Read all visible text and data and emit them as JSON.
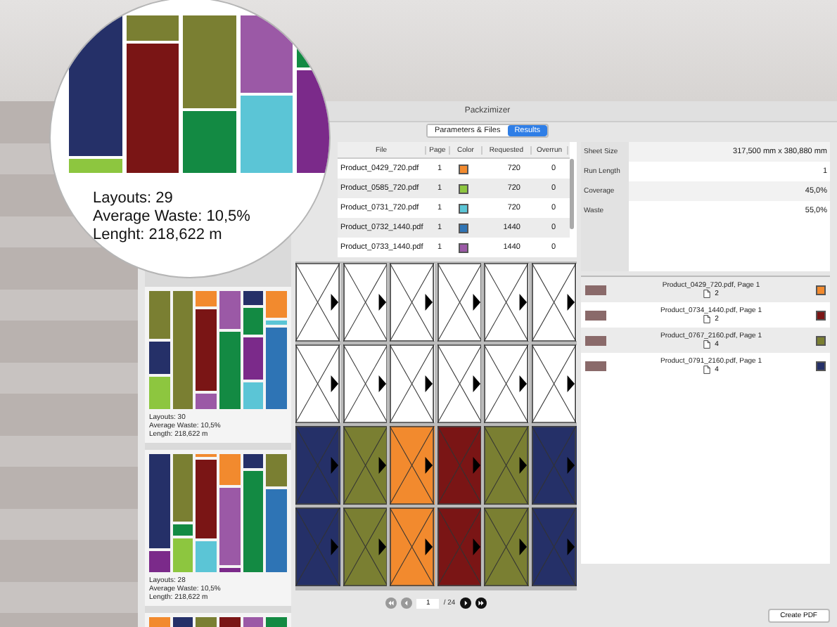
{
  "window": {
    "title": "Packzimizer"
  },
  "tabs": [
    {
      "label": "Parameters & Files",
      "selected": false
    },
    {
      "label": "Results",
      "selected": true
    }
  ],
  "magnifier": {
    "lines": [
      "Layouts: 29",
      "Average Waste: 10,5%",
      "Lenght: 218,622 m"
    ]
  },
  "layouts": [
    {
      "lines": [
        "Layouts: 30",
        "Average Waste: 10,5%",
        "Length: 218,622 m"
      ]
    },
    {
      "lines": [
        "Layouts: 28",
        "Average Waste: 10,5%",
        "Length: 218,622 m"
      ]
    }
  ],
  "files_table": {
    "columns": [
      "File",
      "Page",
      "Color",
      "Requested",
      "Overrun"
    ],
    "rows": [
      {
        "file": "Product_0429_720.pdf",
        "page": "1",
        "color": "#f28a2e",
        "requested": "720",
        "overrun": "0"
      },
      {
        "file": "Product_0585_720.pdf",
        "page": "1",
        "color": "#8dc63f",
        "requested": "720",
        "overrun": "0"
      },
      {
        "file": "Product_0731_720.pdf",
        "page": "1",
        "color": "#5bc5d6",
        "requested": "720",
        "overrun": "0"
      },
      {
        "file": "Product_0732_1440.pdf",
        "page": "1",
        "color": "#2e74b5",
        "requested": "1440",
        "overrun": "0"
      },
      {
        "file": "Product_0733_1440.pdf",
        "page": "1",
        "color": "#9b59a6",
        "requested": "1440",
        "overrun": "0"
      }
    ]
  },
  "sheet_grid": [
    {
      "cells": [
        {
          "color": "#ffffff"
        },
        {
          "color": "#ffffff"
        },
        {
          "color": "#ffffff"
        },
        {
          "color": "#ffffff"
        },
        {
          "color": "#ffffff"
        },
        {
          "color": "#ffffff"
        }
      ]
    },
    {
      "cells": [
        {
          "color": "#ffffff"
        },
        {
          "color": "#ffffff"
        },
        {
          "color": "#ffffff"
        },
        {
          "color": "#ffffff"
        },
        {
          "color": "#ffffff"
        },
        {
          "color": "#ffffff"
        }
      ]
    },
    {
      "cells": [
        {
          "color": "#253068"
        },
        {
          "color": "#7a7f32"
        },
        {
          "color": "#f28a2e"
        },
        {
          "color": "#7a1515"
        },
        {
          "color": "#7a7f32"
        },
        {
          "color": "#253068"
        }
      ]
    },
    {
      "cells": [
        {
          "color": "#253068"
        },
        {
          "color": "#7a7f32"
        },
        {
          "color": "#f28a2e"
        },
        {
          "color": "#7a1515"
        },
        {
          "color": "#7a7f32"
        },
        {
          "color": "#253068"
        }
      ]
    }
  ],
  "pager": {
    "page": "1",
    "total": "/ 24"
  },
  "properties": [
    {
      "label": "Sheet Size",
      "value": "317,500 mm x 380,880 mm"
    },
    {
      "label": "Run Length",
      "value": "1"
    },
    {
      "label": "Coverage",
      "value": "45,0%"
    },
    {
      "label": "Waste",
      "value": "55,0%"
    }
  ],
  "placed": [
    {
      "file": "Product_0429_720.pdf, Page 1",
      "count": "2",
      "color": "#f28a2e"
    },
    {
      "file": "Product_0734_1440.pdf, Page 1",
      "count": "2",
      "color": "#7a1515"
    },
    {
      "file": "Product_0767_2160.pdf, Page 1",
      "count": "4",
      "color": "#7a7f32"
    },
    {
      "file": "Product_0791_2160.pdf, Page 1",
      "count": "4",
      "color": "#253068"
    }
  ],
  "create_button": "Create PDF"
}
